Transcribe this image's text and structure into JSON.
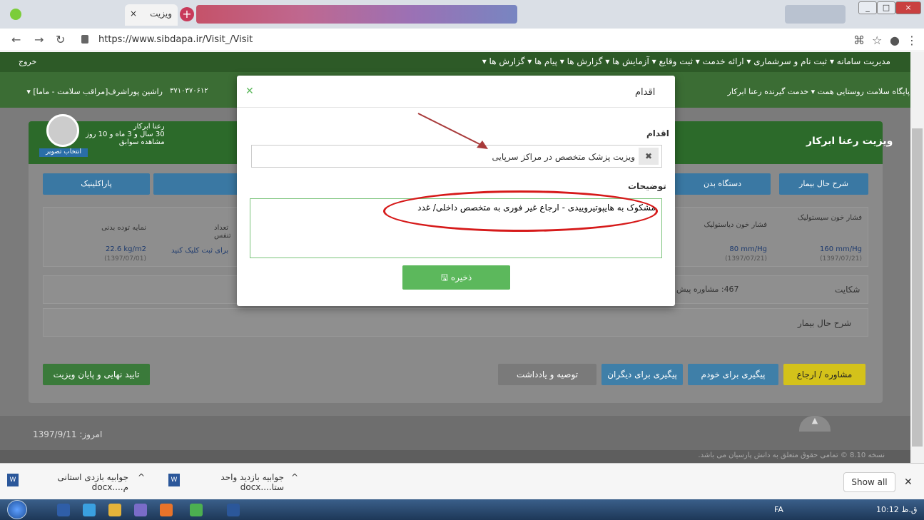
{
  "browser": {
    "tab_title": "ویزیت",
    "tab_close": "×",
    "new_tab": "+",
    "url": "https://www.sibdapa.ir/Visit_/Visit"
  },
  "site": {
    "topnav": "مدیریت سامانه ▾   ثبت نام و سرشماری ▾   ارائه خدمت ▾   ثبت وقایع ▾   آزمایش ها ▾   گزارش ها ▾   پیام ها ▾   گزارش ها ▾",
    "logout": "خروج",
    "subnav_right": "پایگاه سلامت روستایی همت ▾   خدمت گیرنده رعنا ابرکار",
    "subnav_left": "راشین پوراشرف[مراقب سلامت - ماما] ▾",
    "phone": "۳۷۱۰۳۷۰۶۱۲",
    "card_title": "ویزیت رعنا ابرکار",
    "patient_name": "رعنا ابرکار",
    "patient_age": "30 سال و 3 ماه و 10 روز",
    "history": "مشاهده سوابق",
    "avatar_btn": "انتخاب تصویر",
    "tabs": [
      "شرح حال بیمار",
      "دستگاه بدن",
      "پاراکلینیک"
    ],
    "vitals": [
      {
        "label": "فشار خون سیستولیک",
        "value": "160 mm/Hg",
        "date": "(1397/07/21)"
      },
      {
        "label": "فشار خون دیاستولیک",
        "value": "80 mm/Hg",
        "date": "(1397/07/21)"
      },
      {
        "label": "تعداد تنفس",
        "value": "برای ثبت کلیک کنید",
        "date": ""
      },
      {
        "label": "نمایه توده بدنی",
        "value": "22.6 kg/m2",
        "date": "(1397/07/01)"
      }
    ],
    "complaint_label": "شکایت",
    "complaint_value": "467: مشاوره پیش",
    "history_section": "شرح حال بیمار",
    "buttons": {
      "referral": "مشاوره / ارجاع",
      "self_followup": "پیگیری برای خودم",
      "others_followup": "پیگیری برای دیگران",
      "notes": "توصیه و یادداشت",
      "finish": "تایید نهایی و پایان ویزیت"
    },
    "today": "امروز: 1397/9/11",
    "version": "نسخه 8.10  © تمامی حقوق متعلق به دانش پارسیان می باشد."
  },
  "modal": {
    "title": "اقدام",
    "action_label": "اقدام",
    "action_value": "ویزیت پزشک متخصص در مراکز سرپایی",
    "description_label": "توضیحات",
    "description_value": "مشکوک به هایپوتیروییدی - ارجاع غیر فوری به متخصص داخلی/ غدد",
    "save_label": "ذخیره"
  },
  "downloads": [
    {
      "name": "جوابیه بازدید واحد ستا....docx"
    },
    {
      "name": "جوابیه بازدی استانی م....docx"
    }
  ],
  "show_all": "Show all",
  "taskbar": {
    "lang": "FA",
    "time": "10:12 ق.ظ"
  },
  "colors": {
    "accent": "#5cb85c",
    "annotation": "#d61a1a"
  }
}
